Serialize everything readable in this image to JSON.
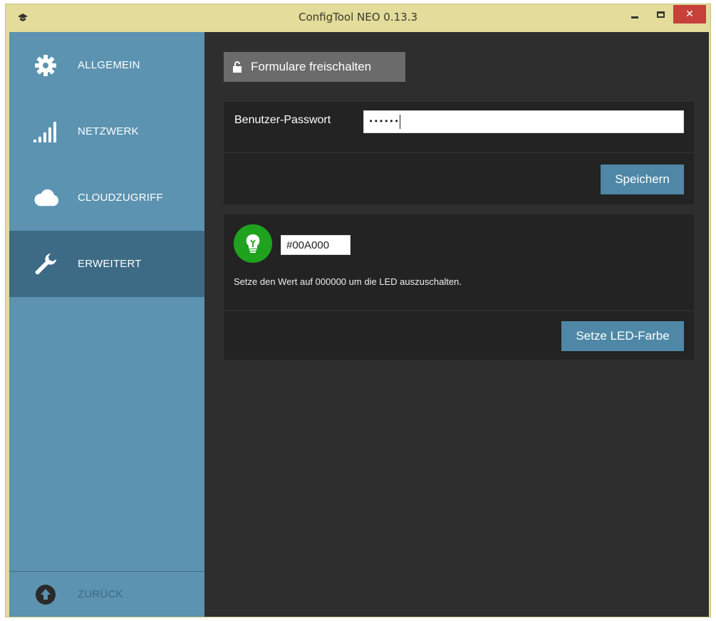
{
  "window": {
    "title": "ConfigTool NEO 0.13.3",
    "minimize_icon": "minimize-icon",
    "maximize_icon": "maximize-icon",
    "close_label": "✕"
  },
  "sidebar": {
    "items": [
      {
        "label": "ALLGEMEIN",
        "icon": "gear-icon"
      },
      {
        "label": "NETZWERK",
        "icon": "signal-bars-icon"
      },
      {
        "label": "CLOUDZUGRIFF",
        "icon": "cloud-icon"
      },
      {
        "label": "ERWEITERT",
        "icon": "wrench-icon",
        "active": true
      }
    ],
    "back": {
      "label": "ZURÜCK",
      "icon": "arrow-up-circle-icon"
    }
  },
  "content": {
    "unlock_button": {
      "label": "Formulare freischalten",
      "icon": "unlock-icon"
    },
    "password_panel": {
      "label": "Benutzer-Passwort",
      "value": "••••••",
      "save_label": "Speichern"
    },
    "led_panel": {
      "icon": "lightbulb-icon",
      "color_value": "#00A000",
      "hint": "Setze den Wert auf 000000 um die LED auszuschalten.",
      "button_label": "Setze LED-Farbe"
    }
  },
  "colors": {
    "sidebar_bg": "#5b93b0",
    "sidebar_active": "#3d6b85",
    "content_bg": "#2e2e2e",
    "panel_bg": "#232323",
    "accent_button": "#4e88a6",
    "led_green": "#1fa31f",
    "titlebar": "#e3dc9a",
    "close_red": "#c7403a"
  }
}
